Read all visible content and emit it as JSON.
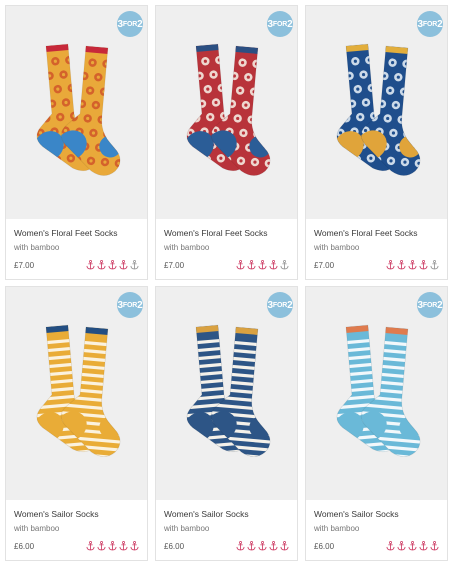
{
  "colors": {
    "badge": "#8cc0dc",
    "rating_on": "#d0456b",
    "rating_off": "#9a9a9a"
  },
  "products": [
    {
      "name": "Women's Floral Feet Socks",
      "sub": "with bamboo",
      "price": "£7.00",
      "badge": {
        "prefix": "3",
        "mid": "FOR",
        "suffix": "2"
      },
      "rating": 4,
      "icon": "anchor-icon",
      "sock": {
        "type": "floral",
        "body": "#e9a93a",
        "cuff": "#c7283a",
        "toe": "#3a86c8",
        "pattern": "#d25a2a"
      }
    },
    {
      "name": "Women's Floral Feet Socks",
      "sub": "with bamboo",
      "price": "£7.00",
      "badge": {
        "prefix": "3",
        "mid": "FOR",
        "suffix": "2"
      },
      "rating": 4,
      "icon": "anchor-icon",
      "sock": {
        "type": "floral",
        "body": "#b8333a",
        "cuff": "#2b4f82",
        "toe": "#2b5d97",
        "pattern": "#f4e9e0"
      }
    },
    {
      "name": "Women's Floral Feet Socks",
      "sub": "with bamboo",
      "price": "£7.00",
      "badge": {
        "prefix": "3",
        "mid": "FOR",
        "suffix": "2"
      },
      "rating": 4,
      "icon": "anchor-icon",
      "sock": {
        "type": "floral",
        "body": "#1f4e8c",
        "cuff": "#e2ae3c",
        "toe": "#e0a43a",
        "pattern": "#dfeaf3"
      }
    },
    {
      "name": "Women's Sailor Socks",
      "sub": "with bamboo",
      "price": "£6.00",
      "badge": {
        "prefix": "3",
        "mid": "FOR",
        "suffix": "2"
      },
      "rating": 5,
      "icon": "anchor-icon",
      "sock": {
        "type": "stripe",
        "body": "#e9ac37",
        "cuff": "#234e82",
        "toe": "#e9ac37",
        "pattern": "#fbf2df"
      }
    },
    {
      "name": "Women's Sailor Socks",
      "sub": "with bamboo",
      "price": "£6.00",
      "badge": {
        "prefix": "3",
        "mid": "FOR",
        "suffix": "2"
      },
      "rating": 5,
      "icon": "anchor-icon",
      "sock": {
        "type": "stripe",
        "body": "#2d5586",
        "cuff": "#d9a141",
        "toe": "#2d5586",
        "pattern": "#f4f1ea"
      }
    },
    {
      "name": "Women's Sailor Socks",
      "sub": "with bamboo",
      "price": "£6.00",
      "badge": {
        "prefix": "3",
        "mid": "FOR",
        "suffix": "2"
      },
      "rating": 5,
      "icon": "anchor-icon",
      "sock": {
        "type": "stripe",
        "body": "#6ab9d8",
        "cuff": "#df7b4e",
        "toe": "#6ab9d8",
        "pattern": "#f2f8fb"
      }
    }
  ]
}
